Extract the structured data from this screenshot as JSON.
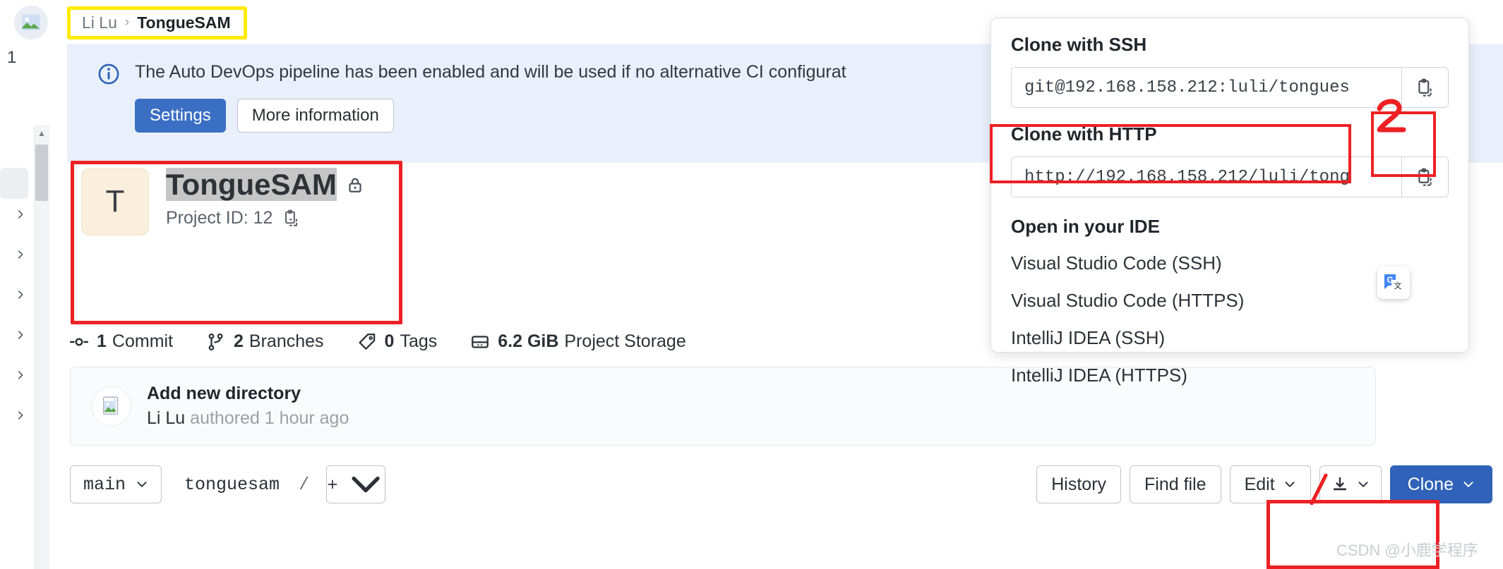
{
  "breadcrumb": {
    "owner": "Li Lu",
    "separator": "›",
    "current": "TongueSAM"
  },
  "alert": {
    "icon": "info-icon",
    "message": "The Auto DevOps pipeline has been enabled and will be used if no alternative CI configurat",
    "settings_label": "Settings",
    "more_info_label": "More information"
  },
  "project": {
    "avatar_initial": "T",
    "name": "TongueSAM",
    "visibility_icon": "lock-icon",
    "project_id_label": "Project ID: 12",
    "copy_icon": "copy-to-clipboard-icon"
  },
  "stats": [
    {
      "icon": "commit-icon",
      "count": "1",
      "label": "Commit"
    },
    {
      "icon": "branch-icon",
      "count": "2",
      "label": "Branches"
    },
    {
      "icon": "tag-icon",
      "count": "0",
      "label": "Tags"
    },
    {
      "icon": "storage-icon",
      "count": "6.2 GiB",
      "label": "Project Storage"
    }
  ],
  "last_commit": {
    "avatar_icon": "image-placeholder-icon",
    "title": "Add new directory",
    "author": "Li Lu",
    "meta": "authored 1 hour ago"
  },
  "toolbar": {
    "branch": "main",
    "path_root": "tonguesam",
    "path_separator": "/",
    "add_icon": "plus-icon",
    "history_label": "History",
    "find_file_label": "Find file",
    "edit_label": "Edit",
    "download_icon": "download-icon",
    "clone_label": "Clone"
  },
  "clone_panel": {
    "ssh_title": "Clone with SSH",
    "ssh_url": "git@192.168.158.212:luli/tongues",
    "http_title": "Clone with HTTP",
    "http_url": "http://192.168.158.212/luli/tong",
    "copy_icon": "copy-to-clipboard-icon",
    "ide_title": "Open in your IDE",
    "ide_items": [
      "Visual Studio Code (SSH)",
      "Visual Studio Code (HTTPS)",
      "IntelliJ IDEA (SSH)",
      "IntelliJ IDEA (HTTPS)"
    ]
  },
  "annotations": {
    "step_two_label": "2",
    "highlight_color": "#ed2024",
    "breadcrumb_highlight_color": "#ffeb00"
  },
  "watermark": "CSDN @小鹿学程序",
  "left_chrome": {
    "tab_count_label": "1"
  }
}
